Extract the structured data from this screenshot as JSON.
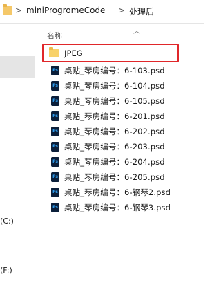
{
  "breadcrumb": {
    "separator": ">",
    "path1": "miniProgromeCode",
    "path2": "处理后"
  },
  "nav": {
    "drive_c": "(C:)",
    "drive_f": "(F:)"
  },
  "list": {
    "column_name": "名称",
    "items": [
      {
        "type": "folder",
        "name": "JPEG",
        "highlighted": true
      },
      {
        "type": "psd",
        "name": "桌贴_琴房编号：6-103.psd"
      },
      {
        "type": "psd",
        "name": "桌贴_琴房编号：6-104.psd"
      },
      {
        "type": "psd",
        "name": "桌贴_琴房编号：6-105.psd"
      },
      {
        "type": "psd",
        "name": "桌贴_琴房编号：6-201.psd"
      },
      {
        "type": "psd",
        "name": "桌贴_琴房编号：6-202.psd"
      },
      {
        "type": "psd",
        "name": "桌贴_琴房编号：6-203.psd"
      },
      {
        "type": "psd",
        "name": "桌贴_琴房编号：6-204.psd"
      },
      {
        "type": "psd",
        "name": "桌贴_琴房编号：6-205.psd"
      },
      {
        "type": "psd",
        "name": "桌贴_琴房编号：6-钢琴2.psd"
      },
      {
        "type": "psd",
        "name": "桌贴_琴房编号：6-钢琴3.psd"
      }
    ],
    "psd_icon_text": "Ps"
  },
  "colors": {
    "highlight_border": "#e0272a",
    "folder": "#f8d26a",
    "ps_icon_bg": "#0b1f3a",
    "ps_icon_text": "#31a8ff"
  }
}
